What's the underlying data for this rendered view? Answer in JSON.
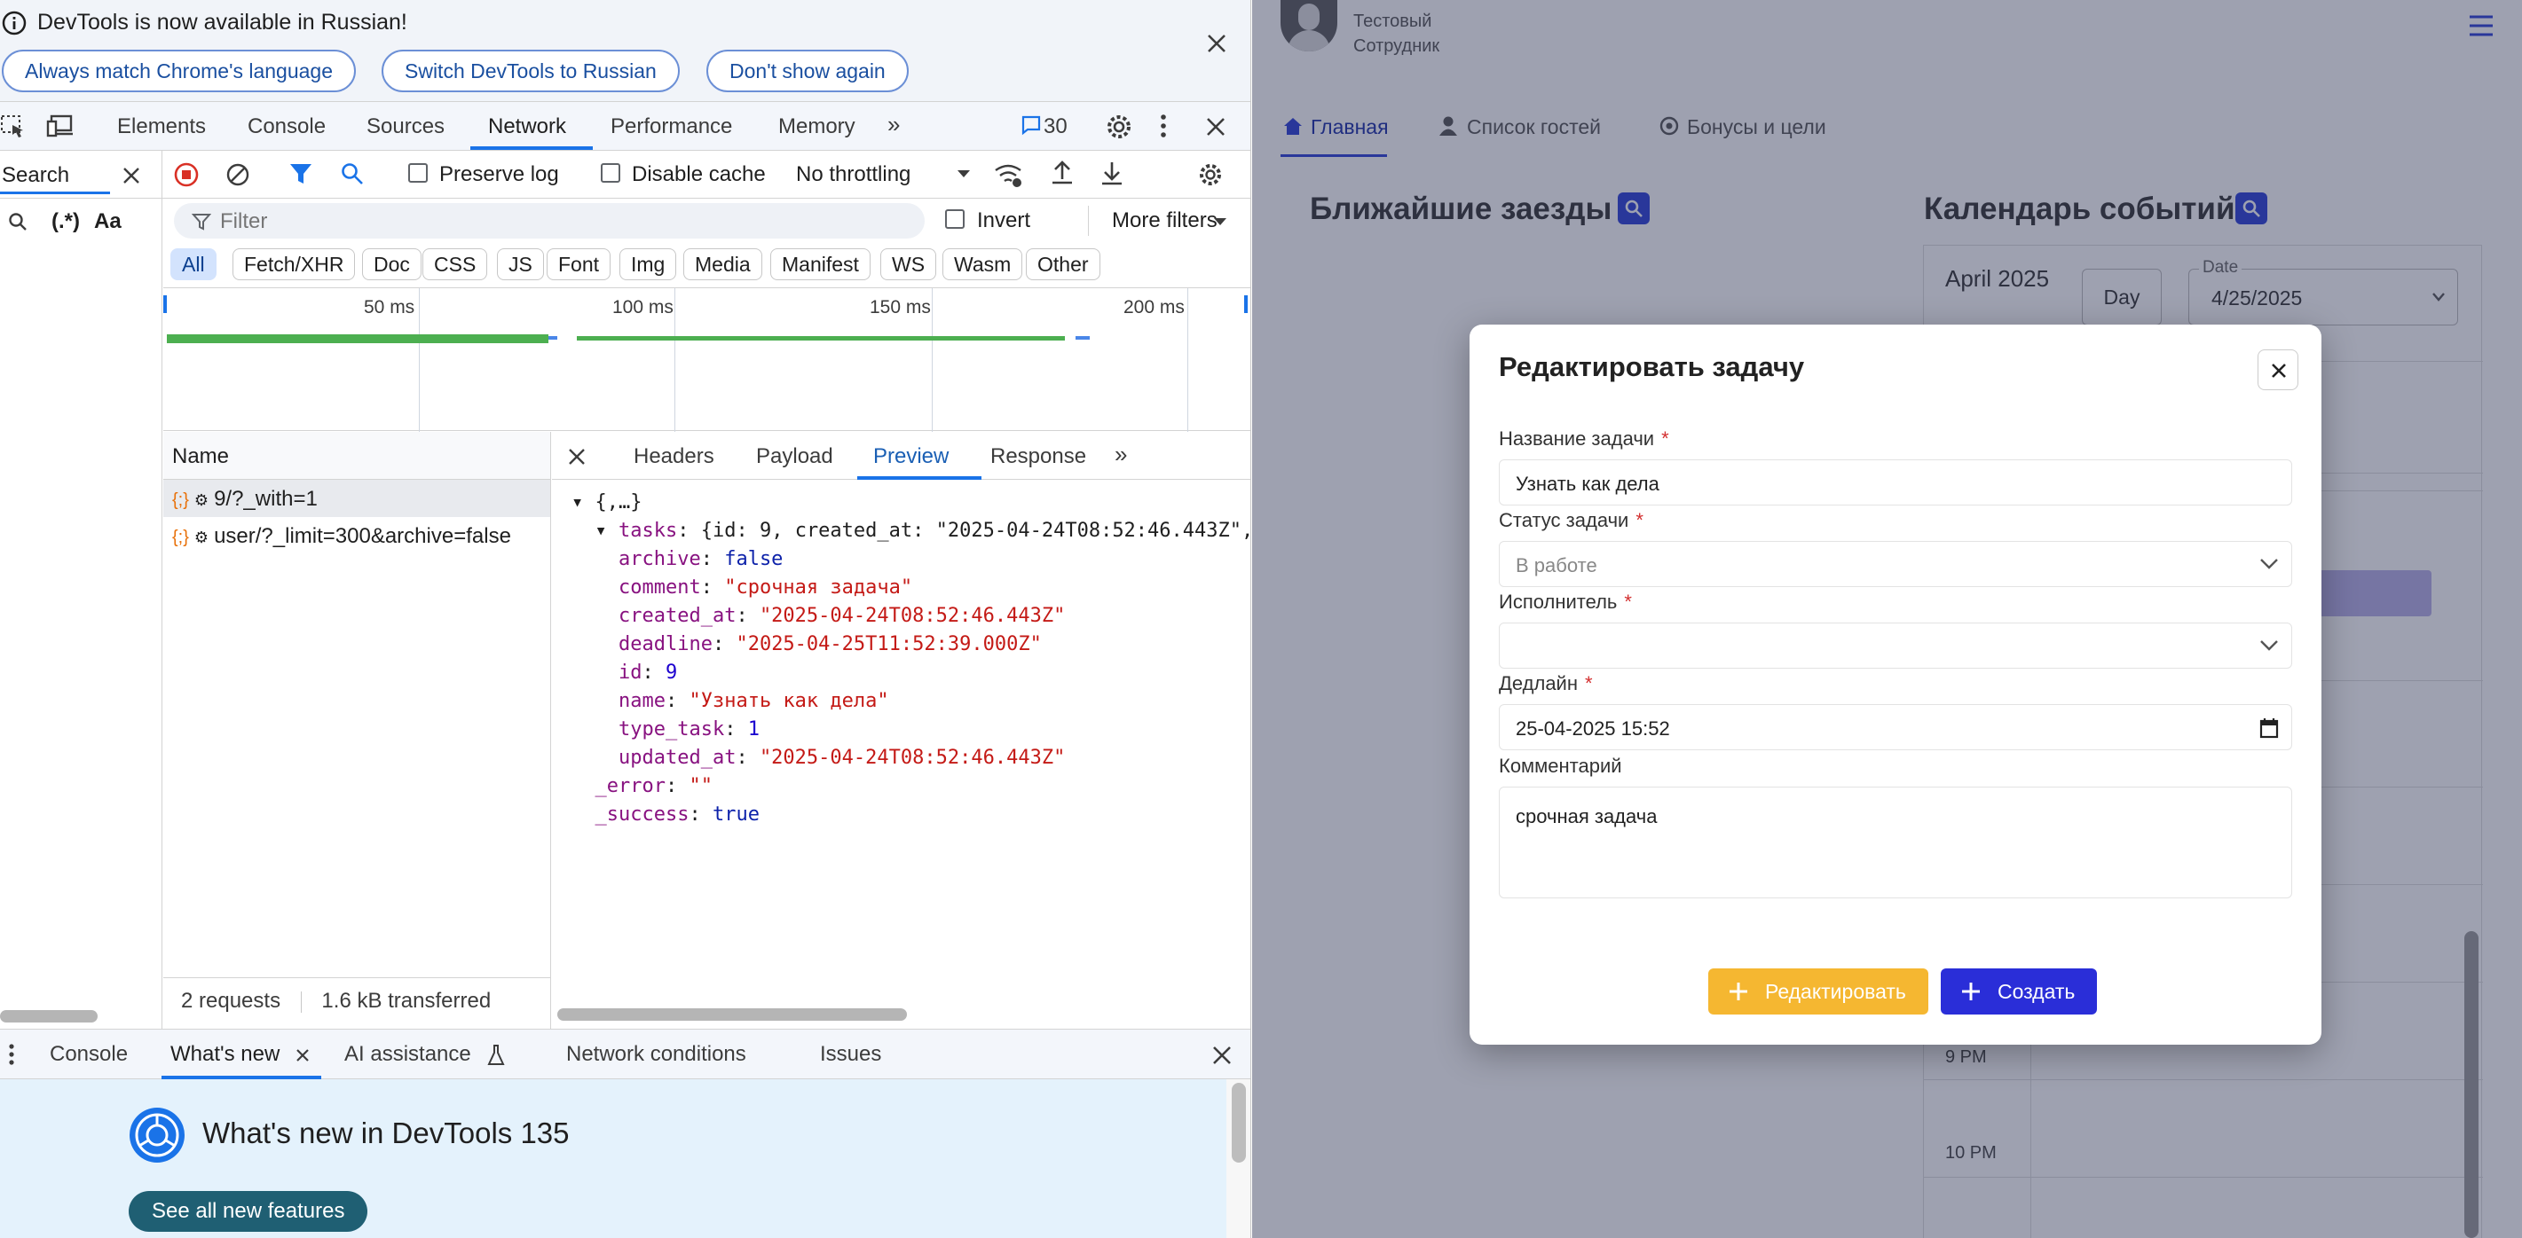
{
  "infobar": {
    "message": "DevTools is now available in Russian!",
    "btn_match": "Always match Chrome's language",
    "btn_switch": "Switch DevTools to Russian",
    "btn_dont_show": "Don't show again"
  },
  "devtools_tabs": {
    "elements": "Elements",
    "console": "Console",
    "sources": "Sources",
    "network": "Network",
    "performance": "Performance",
    "memory": "Memory",
    "message_count": "30"
  },
  "toolbar": {
    "search_label": "Search",
    "preserve_log": "Preserve log",
    "disable_cache": "Disable cache",
    "throttling": "No throttling"
  },
  "filterbar": {
    "regex_label": "(.*)",
    "case_label": "Aa",
    "filter_placeholder": "Filter",
    "invert": "Invert",
    "more_filters": "More filters"
  },
  "type_filters": [
    "All",
    "Fetch/XHR",
    "Doc",
    "CSS",
    "JS",
    "Font",
    "Img",
    "Media",
    "Manifest",
    "WS",
    "Wasm",
    "Other"
  ],
  "overview_ticks": [
    "50 ms",
    "100 ms",
    "150 ms",
    "200 ms"
  ],
  "requests": {
    "header": "Name",
    "rows": [
      "9/?_with=1",
      "user/?_limit=300&archive=false"
    ],
    "summary_requests": "2 requests",
    "summary_transferred": "1.6 kB transferred"
  },
  "detail_tabs": {
    "headers": "Headers",
    "payload": "Payload",
    "preview": "Preview",
    "response": "Response"
  },
  "json_preview": {
    "root": "{,…}",
    "tasks_key": "tasks",
    "tasks_summary": "{id: 9, created_at: \"2025-04-24T08:52:46.443Z\",",
    "archive": "false",
    "comment": "\"срочная задача\"",
    "created_at": "\"2025-04-24T08:52:46.443Z\"",
    "deadline": "\"2025-04-25T11:52:39.000Z\"",
    "id": "9",
    "name": "\"Узнать как дела\"",
    "type_task": "1",
    "updated_at": "\"2025-04-24T08:52:46.443Z\"",
    "error": "\"\"",
    "success": "true"
  },
  "drawer": {
    "tab_console": "Console",
    "tab_whats_new": "What's new",
    "tab_ai": "AI assistance",
    "tab_network_conditions": "Network conditions",
    "tab_issues": "Issues",
    "title": "What's new in DevTools 135",
    "see_all": "See all new features"
  },
  "app": {
    "user_line1": "Тестовый",
    "user_line2": "Сотрудник",
    "nav_home": "Главная",
    "nav_guests": "Список гостей",
    "nav_bonuses": "Бонусы и цели",
    "upcoming_title": "Ближайшие заезды",
    "calendar_title": "Календарь событий",
    "month": "April 2025",
    "day_btn": "Day",
    "date_label": "Date",
    "date_value": "4/25/2025",
    "time_9pm": "9 PM",
    "time_10pm": "10 PM",
    "accent": "#2a3fd8"
  },
  "modal": {
    "title": "Редактировать задачу",
    "name_label": "Название задачи",
    "name_value": "Узнать как дела",
    "status_label": "Статус задачи",
    "status_value": "В работе",
    "assignee_label": "Исполнитель",
    "assignee_value": "",
    "deadline_label": "Дедлайн",
    "deadline_value": "25-04-2025 15:52",
    "comment_label": "Комментарий",
    "comment_value": "срочная задача",
    "required_mark": "*",
    "edit_button": "Редактировать",
    "create_button": "Создать"
  }
}
